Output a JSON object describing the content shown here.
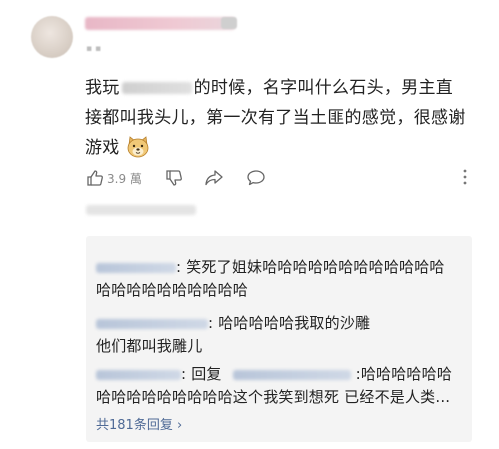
{
  "comment": {
    "line1_prefix": "我玩",
    "line1_suffix": "的时候，名字叫什么石头，男主直",
    "line2": "接都叫我头儿，第一次有了当土匪的感觉，很感谢",
    "line3": "游戏"
  },
  "actions": {
    "like_count": "3.9 萬"
  },
  "replies": [
    {
      "text_line1": ": 笑死了姐妹哈哈哈哈哈哈哈哈哈哈哈哈",
      "text_line2": "哈哈哈哈哈哈哈哈哈哈"
    },
    {
      "text_line1": ": 哈哈哈哈哈我取的沙雕",
      "text_line2": "他们都叫我雕儿"
    },
    {
      "reply_word": ": 回复",
      "text_line1": ":哈哈哈哈哈哈",
      "text_line2": "哈哈哈哈哈哈哈哈哈这个我笑到想死 已经不是人类..."
    }
  ],
  "more_replies": "共181条回复 ›",
  "icons": {
    "like": "thumbs-up-icon",
    "dislike": "thumbs-down-icon",
    "share": "share-icon",
    "comment": "comment-icon",
    "more": "more-vertical-icon",
    "emoji": "doge-emoji-icon"
  }
}
